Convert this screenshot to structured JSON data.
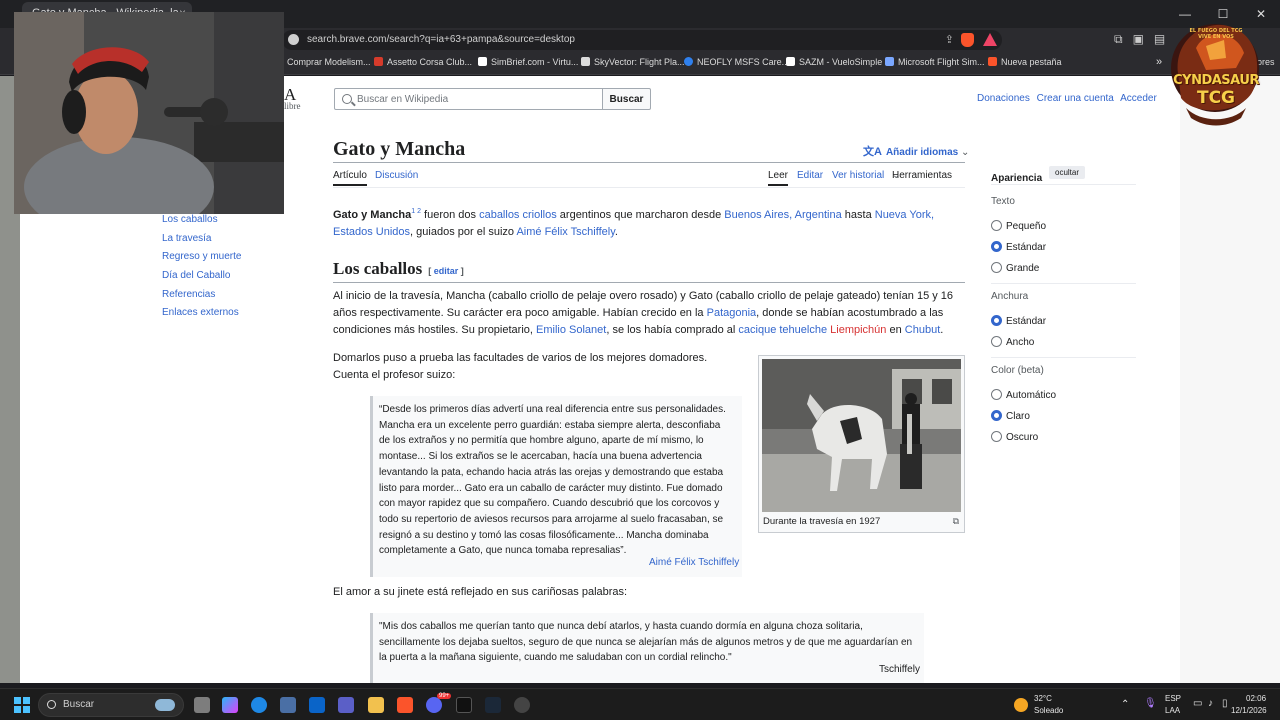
{
  "browser": {
    "tab_title": "Gato y Mancha - Wikipedia, la...",
    "tab_close": "×",
    "url": "search.brave.com/search?q=ia+63+pampa&source=desktop",
    "window_controls": [
      "—",
      "☐",
      "✕"
    ],
    "bookmarks": [
      {
        "label": "Comprar Modelism...",
        "color": "#e8e8e8"
      },
      {
        "label": "Assetto Corsa Club...",
        "color": "#d63b2b"
      },
      {
        "label": "SimBrief.com - Virtu...",
        "color": "#ffffff"
      },
      {
        "label": "SkyVector: Flight Pla...",
        "color": "#dddddd"
      },
      {
        "label": "NEOFLY MSFS Care...",
        "color": "#2f80ed"
      },
      {
        "label": "SAZM - VueloSimple",
        "color": "#ffffff"
      },
      {
        "label": "Microsoft Flight Sim...",
        "color": "#7aa7ff"
      },
      {
        "label": "Nueva pestaña",
        "color": "#fb542b"
      }
    ],
    "bookmarks_more": "»",
    "bookmarks_tail": "dores"
  },
  "wiki": {
    "logo_tail": "A",
    "logo_sub": "libre",
    "search_placeholder": "Buscar en Wikipedia",
    "search_button": "Buscar",
    "top_links": [
      "Donaciones",
      "Crear una cuenta",
      "Acceder"
    ],
    "title": "Gato y Mancha",
    "add_languages": "Añadir idiomas",
    "tabs_left": [
      "Artículo",
      "Discusión"
    ],
    "tabs_right": [
      "Leer",
      "Editar",
      "Ver historial",
      "Herramientas"
    ],
    "toc": [
      "Los caballos",
      "La travesía",
      "Regreso y muerte",
      "Día del Caballo",
      "Referencias",
      "Enlaces externos"
    ],
    "intro": {
      "bold": "Gato y Mancha",
      "sup": "1 2",
      "t1": " fueron dos ",
      "l1": "caballos criollos",
      "t2": " argentinos que marcharon desde ",
      "l2": "Buenos Aires, Argentina",
      "t3": " hasta ",
      "l3": "Nueva York, Estados Unidos",
      "t4": ", guiados por el suizo ",
      "l4": "Aimé Félix Tschiffely",
      "t5": "."
    },
    "section_heading": "Los caballos",
    "section_edit": "editar",
    "p1": {
      "t1": "Al inicio de la travesía, Mancha (caballo criollo de pelaje overo rosado) y Gato (caballo criollo de pelaje gateado) tenían 15 y 16 años respectivamente. Su carácter era poco amigable. Habían crecido en la ",
      "l1": "Patagonia",
      "t2": ", donde se habían acostumbrado a las condiciones más hostiles. Su propietario, ",
      "l2": "Emilio Solanet",
      "t3": ", se los había comprado al ",
      "l3": "cacique tehuelche",
      "t4": " ",
      "l4": "Liempichún",
      "t5": " en ",
      "l5": "Chubut",
      "t6": "."
    },
    "p2": "Domarlos puso a prueba las facultades de varios de los mejores domadores. Cuenta el profesor suizo:",
    "quote1": "“Desde los primeros días advertí una real diferencia entre sus personalidades. Mancha era un excelente perro guardián: estaba siempre alerta, desconfiaba de los extraños y no permitía que hombre alguno, aparte de mí mismo, lo montase... Si los extraños se le acercaban, hacía una buena advertencia levantando la pata, echando hacia atrás las orejas y demostrando que estaba listo para morder... Gato era un caballo de carácter muy distinto. Fue domado con mayor rapidez que su compañero. Cuando descubrió que los corcovos y todo su repertorio de aviesos recursos para arrojarme al suelo fracasaban, se resignó a su destino y tomó las cosas filosóficamente... Mancha dominaba completamente a Gato, que nunca tomaba represalias”.",
    "quote1_attr": "Aimé Félix Tschiffely",
    "p3": "El amor a su jinete está reflejado en sus cariñosas palabras:",
    "quote2": "\"Mis dos caballos me querían tanto que nunca debí atarlos, y hasta cuando dormía en alguna choza solitaria, sencillamente los dejaba sueltos, seguro de que nunca se alejarían más de algunos metros y de que me aguardarían en la puerta a la mañana siguiente, cuando me saludaban con un cordial relincho.\"",
    "quote2_attr": "Tschiffely",
    "figure_caption": "Durante la travesía en 1927",
    "appearance": {
      "title": "Apariencia",
      "hide": "ocultar",
      "texto": "Texto",
      "texto_opts": [
        "Pequeño",
        "Estándar",
        "Grande"
      ],
      "anchura": "Anchura",
      "anchura_opts": [
        "Estándar",
        "Ancho"
      ],
      "color": "Color (beta)",
      "color_opts": [
        "Automático",
        "Claro",
        "Oscuro"
      ]
    }
  },
  "overlay_logo": {
    "arc": "EL FUEGO DEL TCG VIVE EN VOS",
    "name": "CYNDASAUR",
    "tcg": "TCG"
  },
  "taskbar": {
    "search": "Buscar",
    "temp": "32°C",
    "weather": "Soleado",
    "lang1": "ESP",
    "lang2": "LAA",
    "time": "02:06",
    "date": "12/1/2026",
    "badge": "99+"
  }
}
